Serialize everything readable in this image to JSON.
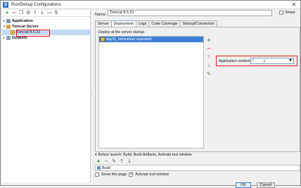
{
  "window": {
    "title": "Run/Debug Configurations",
    "app_icon_text": "IJ"
  },
  "left_toolbar": {
    "icons": [
      "add-icon",
      "remove-icon",
      "copy-icon",
      "settings-icon",
      "move-up-icon",
      "move-down-icon",
      "folder-icon",
      "sort-icon"
    ]
  },
  "tree": {
    "application": "Application",
    "tomcat_server": "Tomcat Server",
    "tomcat_instance": "Tomcat 8.5.31",
    "defaults": "Defaults"
  },
  "form": {
    "name_label": "Name:",
    "name_value": "Tomcat 8.5.31",
    "share_label": "Share"
  },
  "tabs": [
    {
      "label": "Server"
    },
    {
      "label": "Deployment"
    },
    {
      "label": "Logs"
    },
    {
      "label": "Code Coverage"
    },
    {
      "label": "Startup/Connection"
    }
  ],
  "deployment": {
    "header": "Deploy at the server startup",
    "items": [
      "day11_tomcatwar exploded"
    ],
    "context_label": "Application context:",
    "context_value": "/"
  },
  "before_launch": {
    "label": "Before launch: Build, Build Artifacts, Activate tool window",
    "items": [
      "Build"
    ]
  },
  "options": {
    "show_page": "Show this page",
    "activate_tool_window": "Activate tool window"
  },
  "buttons": {
    "ok": "OK",
    "cancel": "Cancel"
  },
  "colors": {
    "selection": "#3d80d5",
    "highlight": "#e0141e"
  }
}
